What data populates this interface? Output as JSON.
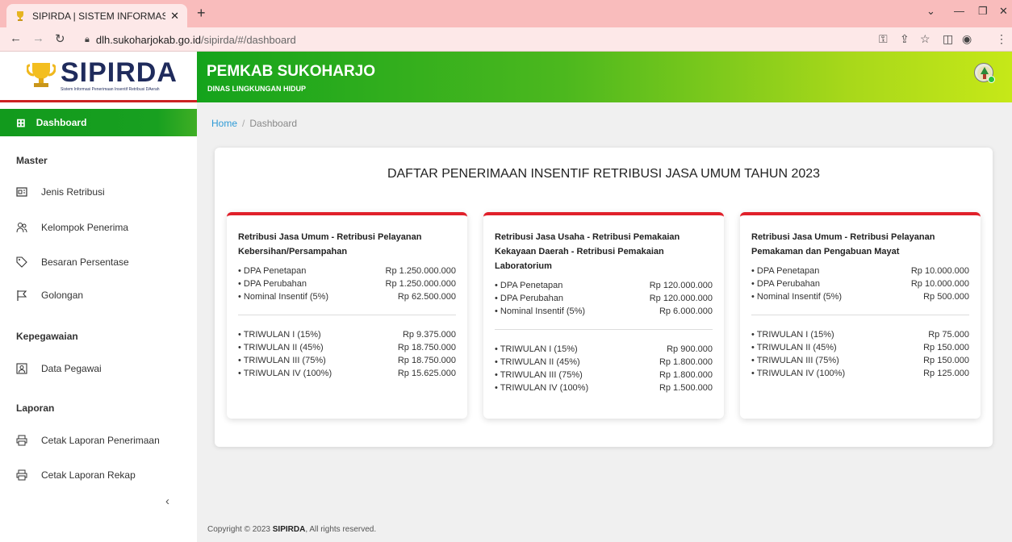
{
  "browser": {
    "tab_title": "SIPIRDA | SISTEM INFORMASI PE",
    "url_host": "dlh.sukoharjokab.go.id",
    "url_path": "/sipirda/#/dashboard"
  },
  "logo": {
    "name": "SIPIRDA",
    "tagline": "Sistem Informasi Penerimaan Insentif Retribusi DAerah"
  },
  "header": {
    "title": "PEMKAB SUKOHARJO",
    "subtitle": "DINAS LINGKUNGAN HIDUP"
  },
  "sidebar": {
    "active": "Dashboard",
    "sections": [
      {
        "title": "Master",
        "items": [
          "Jenis Retribusi",
          "Kelompok Penerima",
          "Besaran Persentase",
          "Golongan"
        ]
      },
      {
        "title": "Kepegawaian",
        "items": [
          "Data Pegawai"
        ]
      },
      {
        "title": "Laporan",
        "items": [
          "Cetak Laporan Penerimaan",
          "Cetak Laporan Rekap"
        ]
      }
    ]
  },
  "breadcrumb": {
    "home": "Home",
    "sep": "/",
    "current": "Dashboard"
  },
  "panel_title": "DAFTAR PENERIMAAN INSENTIF RETRIBUSI JASA UMUM TAHUN 2023",
  "cards": [
    {
      "title": "Retribusi Jasa Umum - Retribusi Pelayanan Kebersihan/Persampahan",
      "summary": [
        {
          "label": "• DPA Penetapan",
          "value": "Rp 1.250.000.000"
        },
        {
          "label": "• DPA Perubahan",
          "value": "Rp 1.250.000.000"
        },
        {
          "label": "• Nominal Insentif (5%)",
          "value": "Rp 62.500.000"
        }
      ],
      "quarters": [
        {
          "label": "• TRIWULAN I (15%)",
          "value": "Rp 9.375.000"
        },
        {
          "label": "• TRIWULAN II (45%)",
          "value": "Rp 18.750.000"
        },
        {
          "label": "• TRIWULAN III (75%)",
          "value": "Rp 18.750.000"
        },
        {
          "label": "• TRIWULAN IV (100%)",
          "value": "Rp 15.625.000"
        }
      ]
    },
    {
      "title": "Retribusi Jasa Usaha - Retribusi Pemakaian Kekayaan Daerah - Retribusi Pemakaian Laboratorium",
      "summary": [
        {
          "label": "• DPA Penetapan",
          "value": "Rp 120.000.000"
        },
        {
          "label": "• DPA Perubahan",
          "value": "Rp 120.000.000"
        },
        {
          "label": "• Nominal Insentif (5%)",
          "value": "Rp 6.000.000"
        }
      ],
      "quarters": [
        {
          "label": "• TRIWULAN I (15%)",
          "value": "Rp 900.000"
        },
        {
          "label": "• TRIWULAN II (45%)",
          "value": "Rp 1.800.000"
        },
        {
          "label": "• TRIWULAN III (75%)",
          "value": "Rp 1.800.000"
        },
        {
          "label": "• TRIWULAN IV (100%)",
          "value": "Rp 1.500.000"
        }
      ]
    },
    {
      "title": "Retribusi Jasa Umum - Retribusi Pelayanan Pemakaman dan Pengabuan Mayat",
      "summary": [
        {
          "label": "• DPA Penetapan",
          "value": "Rp 10.000.000"
        },
        {
          "label": "• DPA Perubahan",
          "value": "Rp 10.000.000"
        },
        {
          "label": "• Nominal Insentif (5%)",
          "value": "Rp 500.000"
        }
      ],
      "quarters": [
        {
          "label": "• TRIWULAN I (15%)",
          "value": "Rp 75.000"
        },
        {
          "label": "• TRIWULAN II (45%)",
          "value": "Rp 150.000"
        },
        {
          "label": "• TRIWULAN III (75%)",
          "value": "Rp 150.000"
        },
        {
          "label": "• TRIWULAN IV (100%)",
          "value": "Rp 125.000"
        }
      ]
    }
  ],
  "footer": {
    "prefix": "Copyright © 2023 ",
    "brand": "SIPIRDA",
    "suffix": ", All rights reserved."
  },
  "colors": {
    "accent_green": "#18a020",
    "card_top": "#e0202a",
    "logo_navy": "#1f2b5c"
  }
}
